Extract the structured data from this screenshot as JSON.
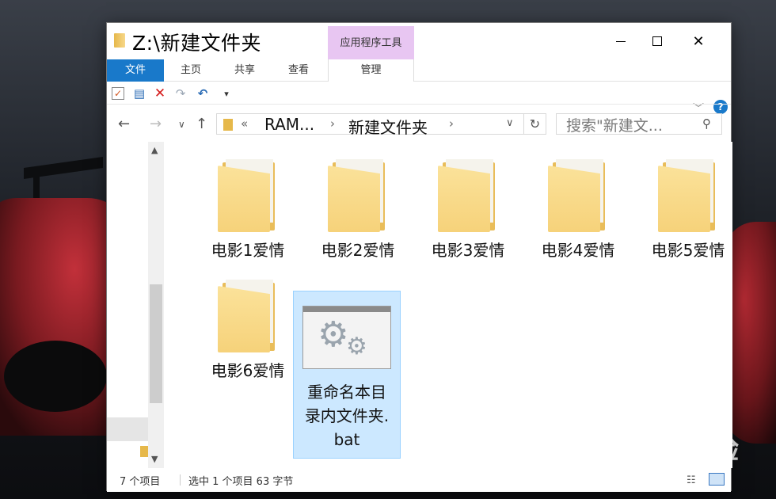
{
  "window": {
    "title": "Z:\\新建文件夹",
    "contextual_group": "应用程序工具",
    "controls": {
      "minimize": "",
      "maximize": "",
      "close": "✕"
    }
  },
  "ribbon": {
    "tabs": [
      {
        "label": "文件",
        "active": true
      },
      {
        "label": "主页"
      },
      {
        "label": "共享"
      },
      {
        "label": "查看"
      },
      {
        "label": "管理"
      }
    ],
    "help": "?"
  },
  "quick_access": {
    "more": "▾"
  },
  "navigation": {
    "address": {
      "prefix": "«",
      "segment1": "RAM...",
      "segment2": "新建文件夹"
    },
    "search_placeholder": "搜索\"新建文...",
    "icons": [
      "back-arrow-icon",
      "forward-arrow-icon",
      "recent-dropdown-icon",
      "up-arrow-icon",
      "refresh-icon",
      "search-icon"
    ]
  },
  "items": [
    {
      "name": "电影1爱情",
      "type": "folder"
    },
    {
      "name": "电影2爱情",
      "type": "folder"
    },
    {
      "name": "电影3爱情",
      "type": "folder"
    },
    {
      "name": "电影4爱情",
      "type": "folder"
    },
    {
      "name": "电影5爱情",
      "type": "folder"
    },
    {
      "name": "电影6爱情",
      "type": "folder"
    },
    {
      "name_lines": [
        "重命名本目",
        "录内文件夹.",
        "bat"
      ],
      "type": "bat",
      "selected": true
    }
  ],
  "status": {
    "count": "7 个项目",
    "selection": "选中 1 个项目  63 字节"
  },
  "watermark": {
    "main": "Baidu经验",
    "sub": "jingyan.baidu.com"
  },
  "colors": {
    "accent": "#1979ca",
    "selection": "#cce8ff",
    "contextual": "#e8c6f2",
    "folder": "#f6d27a"
  }
}
